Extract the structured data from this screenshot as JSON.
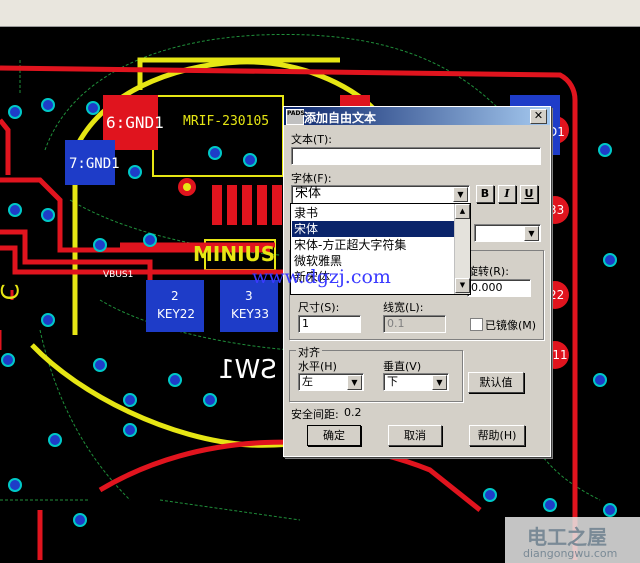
{
  "dialog": {
    "title": "添加自由文本",
    "close": "✕",
    "logo": "PADS",
    "text_label": "文本(T):",
    "text_value": "",
    "font_label": "字体(F):",
    "font_value": "宋体",
    "bold": "B",
    "italic": "I",
    "underline": "U",
    "rotate_label": "旋转(R):",
    "rotate_value": "0.000",
    "size_label": "尺寸(S):",
    "size_value": "1",
    "linewidth_label": "线宽(L):",
    "linewidth_value": "0.1",
    "mirror_label": "已镜像(M)",
    "align_label": "对齐",
    "horizontal_label": "水平(H)",
    "horizontal_value": "左",
    "vertical_label": "垂直(V)",
    "vertical_value": "下",
    "default_button": "默认值",
    "safety_label": "安全间距:",
    "safety_value": "0.2",
    "ok_button": "确定",
    "cancel_button": "取消",
    "help_button": "帮助(H)"
  },
  "font_dropdown": {
    "items": [
      "隶书",
      "宋体",
      "宋体-方正超大字符集",
      "微软雅黑",
      "新宋体"
    ],
    "selected_index": 1
  },
  "pcb": {
    "labels": {
      "gnd6": "6:GND1",
      "gnd7": "7:GND1",
      "mrif": "MRIF-230105",
      "minius": "MINIUS",
      "vbus": "VBUS1",
      "key2_num": "2",
      "key2_name": "KEY22",
      "key3_num": "3",
      "key3_name": "KEY33",
      "sw1": "SW1",
      "c_left": "C",
      "right_d1": "D1",
      "right_33": "33",
      "right_22": "22",
      "right_y11": "Y11"
    },
    "watermark_url": "www.dgzj.com",
    "watermark_brand": "电工之屋",
    "watermark_domain": "diangongwu.com"
  },
  "colors": {
    "trace_red": "#e0141e",
    "silk_yellow": "#e6e614",
    "pad_blue": "#1e3cc8",
    "via_cyan": "#00c8c8",
    "arrow_red": "#e8141e"
  }
}
